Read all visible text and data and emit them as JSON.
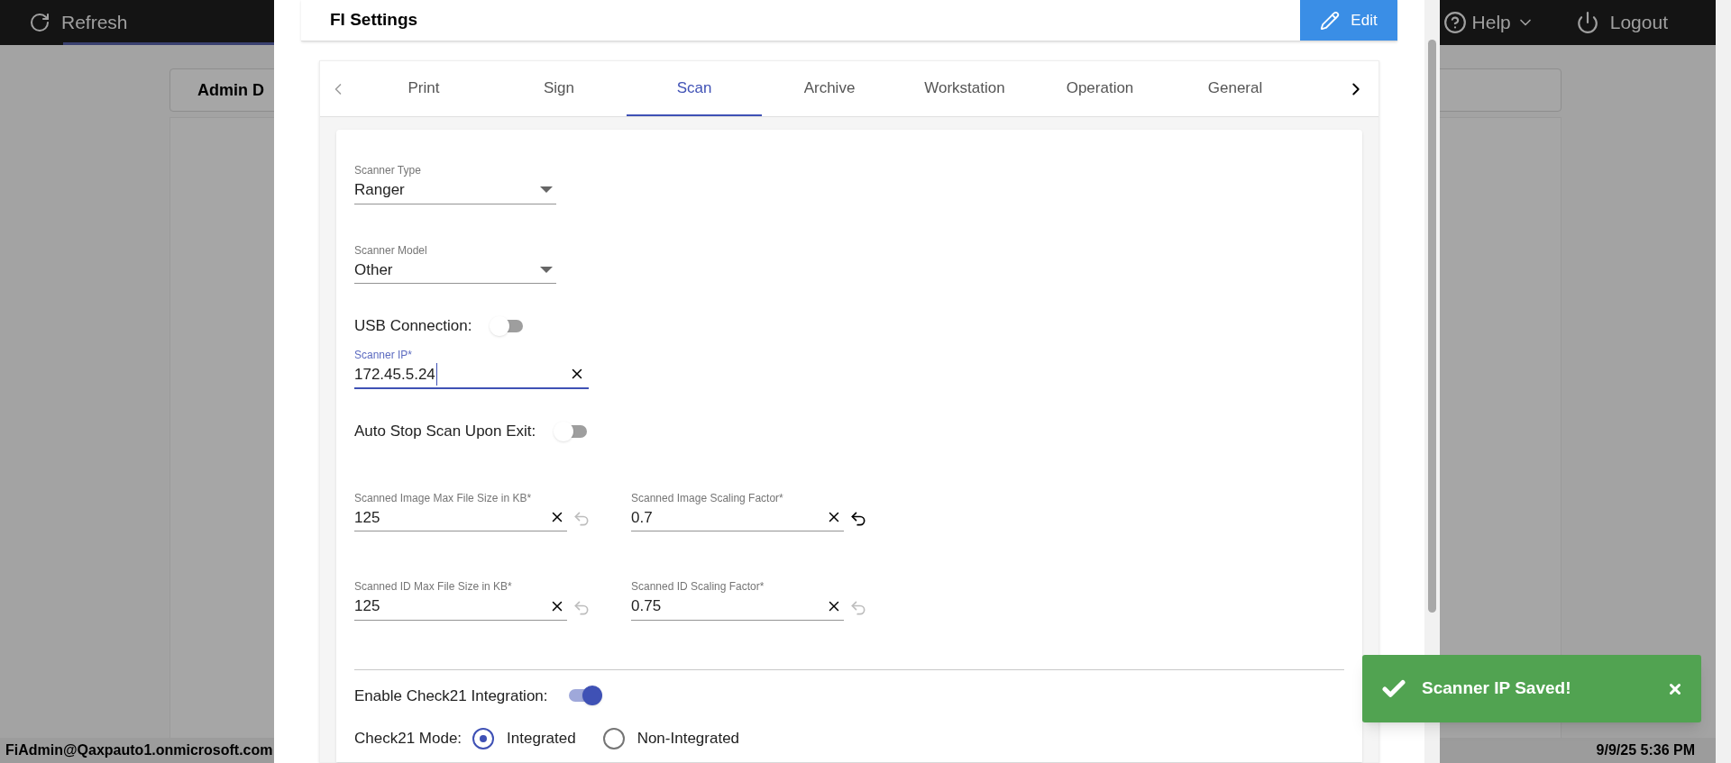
{
  "top_bar": {
    "refresh": "Refresh",
    "help": "Help",
    "logout": "Logout"
  },
  "background_page": {
    "card_title": "Admin D",
    "status_user": "FiAdmin@Qaxpauto1.onmicrosoft.com",
    "status_time": "9/9/25 5:36 PM"
  },
  "dialog": {
    "title": "FI Settings",
    "edit_button": "Edit",
    "tabs": [
      {
        "label": "Print",
        "selected": false
      },
      {
        "label": "Sign",
        "selected": false
      },
      {
        "label": "Scan",
        "selected": true
      },
      {
        "label": "Archive",
        "selected": false
      },
      {
        "label": "Workstation",
        "selected": false
      },
      {
        "label": "Operation",
        "selected": false
      },
      {
        "label": "General",
        "selected": false
      }
    ],
    "rows": [
      {
        "kind": "select",
        "label": "Scanner Type",
        "value": "Ranger"
      },
      {
        "kind": "select",
        "label": "Scanner Model",
        "value": "Other"
      },
      {
        "kind": "toggle",
        "label": "USB Connection:",
        "on": false
      },
      {
        "kind": "text",
        "label": "Scanner IP*",
        "value": "172.45.5.24",
        "focused": true
      },
      {
        "kind": "toggle",
        "label": "Auto Stop Scan Upon Exit:",
        "on": false
      },
      {
        "kind": "pair",
        "fields": [
          {
            "label": "Scanned Image Max File Size in KB*",
            "value": "125",
            "undo_enabled": false
          },
          {
            "label": "Scanned Image Scaling Factor*",
            "value": "0.7",
            "undo_enabled": true
          }
        ]
      },
      {
        "kind": "pair",
        "fields": [
          {
            "label": "Scanned ID Max File Size in KB*",
            "value": "125",
            "undo_enabled": false
          },
          {
            "label": "Scanned ID Scaling Factor*",
            "value": "0.75",
            "undo_enabled": false
          }
        ]
      },
      {
        "kind": "divider"
      },
      {
        "kind": "toggle",
        "label": "Enable Check21 Integration:",
        "on": true
      },
      {
        "kind": "radio",
        "label": "Check21 Mode:",
        "options": [
          {
            "label": "Integrated",
            "selected": true
          },
          {
            "label": "Non-Integrated",
            "selected": false
          }
        ]
      }
    ]
  },
  "toast": {
    "message": "Scanner IP Saved!"
  }
}
